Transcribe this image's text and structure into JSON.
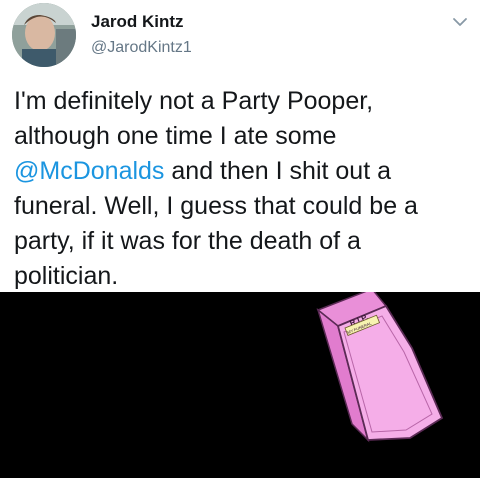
{
  "user": {
    "name": "Jarod Kintz",
    "handle": "@JarodKintz1"
  },
  "tweet": {
    "text_before": "I'm definitely not a Party Pooper, although one time I ate some ",
    "mention": "@McDonalds",
    "text_after": " and then I shit out a funeral. Well, I guess that could be a party, if it was for the death of a politician."
  },
  "media": {
    "coffin_label": "R.I.P.",
    "coffin_plaque": "MY FUNERAL"
  },
  "icons": [
    "chevron-down-icon"
  ],
  "colors": {
    "link": "#1b95e0",
    "text": "#14171a",
    "secondary": "#657786",
    "coffin_pink": "#f4a9e6",
    "media_background": "#000000"
  }
}
